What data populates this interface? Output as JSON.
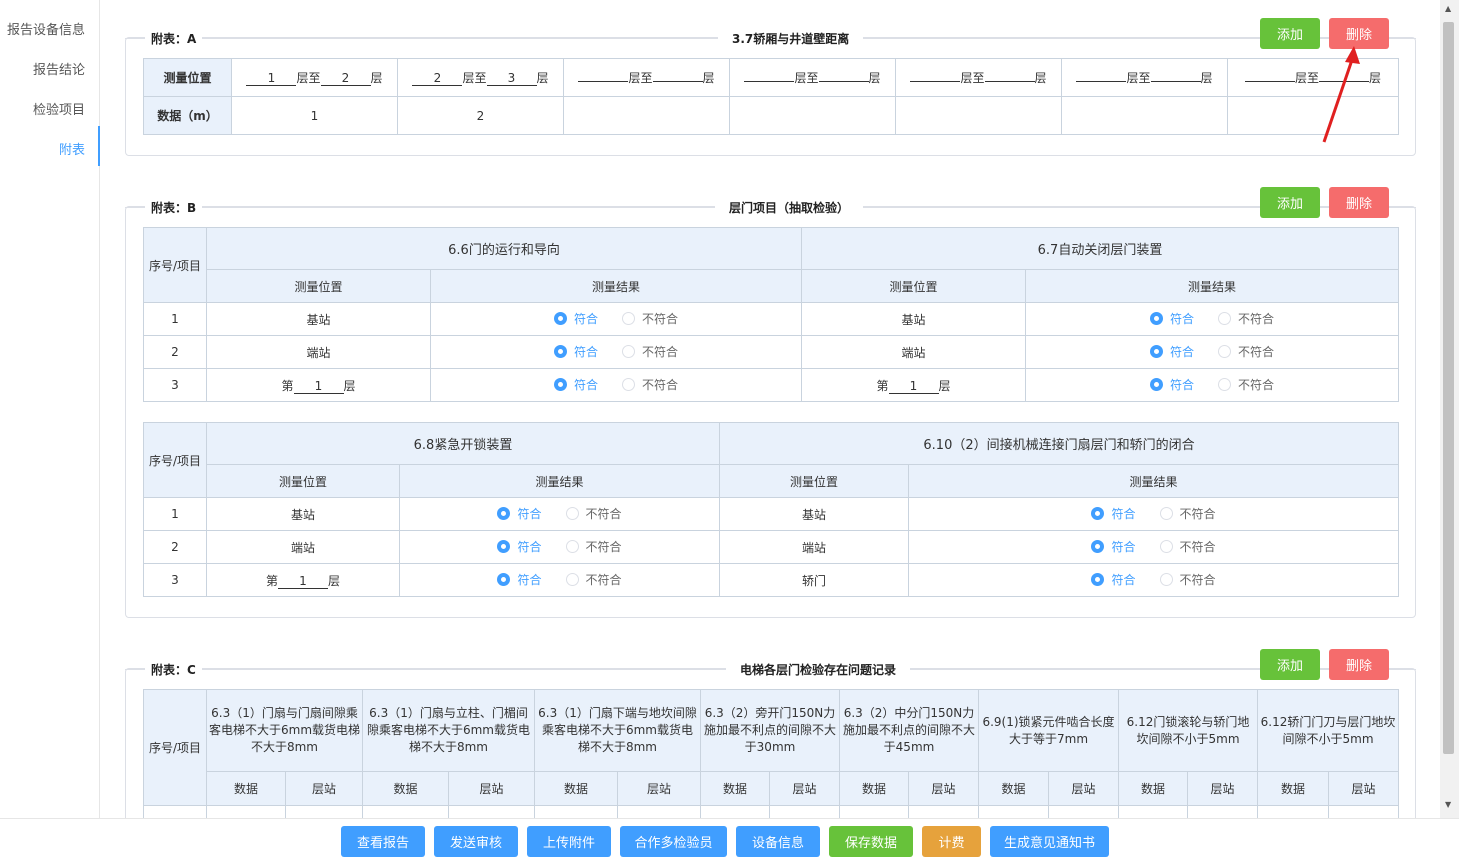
{
  "sidebar": {
    "items": [
      {
        "label": "报告设备信息"
      },
      {
        "label": "报告结论"
      },
      {
        "label": "检验项目"
      },
      {
        "label": "附表"
      }
    ]
  },
  "buttons": {
    "add": "添加",
    "delete": "删除"
  },
  "sectionA": {
    "label": "附表：A",
    "title": "3.7轿厢与井道壁距离",
    "row_position": "测量位置",
    "row_data": "数据（m）",
    "floor_to": "层至",
    "floor": "层",
    "cols": [
      {
        "from": "1",
        "to": "2",
        "data": "1"
      },
      {
        "from": "2",
        "to": "3",
        "data": "2"
      },
      {
        "from": "",
        "to": "",
        "data": ""
      },
      {
        "from": "",
        "to": "",
        "data": ""
      },
      {
        "from": "",
        "to": "",
        "data": ""
      },
      {
        "from": "",
        "to": "",
        "data": ""
      },
      {
        "from": "",
        "to": "",
        "data": ""
      }
    ]
  },
  "sectionB": {
    "label": "附表：B",
    "title": "层门项目（抽取检验）",
    "seq": "序号/项目",
    "pos": "测量位置",
    "result": "测量结果",
    "ok": "符合",
    "nok": "不符合",
    "prefix_di": "第",
    "suffix_ceng": "层",
    "table1": {
      "group1": "6.6门的运行和导向",
      "group2": "6.7自动关闭层门装置",
      "rows": [
        {
          "n": "1",
          "p1": "基站",
          "p2": "基站"
        },
        {
          "n": "2",
          "p1": "端站",
          "p2": "端站"
        },
        {
          "n": "3",
          "p1_floor": "1",
          "p2_floor": "1"
        }
      ]
    },
    "table2": {
      "group1": "6.8紧急开锁装置",
      "group2": "6.10（2）间接机械连接门扇层门和轿门的闭合",
      "rows": [
        {
          "n": "1",
          "p1": "基站",
          "p2": "基站"
        },
        {
          "n": "2",
          "p1": "端站",
          "p2": "端站"
        },
        {
          "n": "3",
          "p1_floor": "1",
          "p2": "轿门"
        }
      ]
    }
  },
  "sectionC": {
    "label": "附表：C",
    "title": "电梯各层门检验存在问题记录",
    "seq": "序号/项目",
    "data": "数据",
    "station": "层站",
    "cols": [
      "6.3（1）门扇与门扇间隙乘客电梯不大于6mm载货电梯不大于8mm",
      "6.3（1）门扇与立柱、门楣间隙乘客电梯不大于6mm载货电梯不大于8mm",
      "6.3（1）门扇下端与地坎间隙乘客电梯不大于6mm载货电梯不大于8mm",
      "6.3（2）旁开门150N力施加最不利点的间隙不大于30mm",
      "6.3（2）中分门150N力施加最不利点的间隙不大于45mm",
      "6.9(1)锁紧元件啮合长度大于等于7mm",
      "6.12门锁滚轮与轿门地坎间隙不小于5mm",
      "6.12轿门门刀与层门地坎间隙不小于5mm"
    ]
  },
  "bottom": [
    {
      "label": "查看报告"
    },
    {
      "label": "发送审核"
    },
    {
      "label": "上传附件"
    },
    {
      "label": "合作多检验员"
    },
    {
      "label": "设备信息"
    },
    {
      "label": "保存数据"
    },
    {
      "label": "计费"
    },
    {
      "label": "生成意见通知书"
    }
  ]
}
